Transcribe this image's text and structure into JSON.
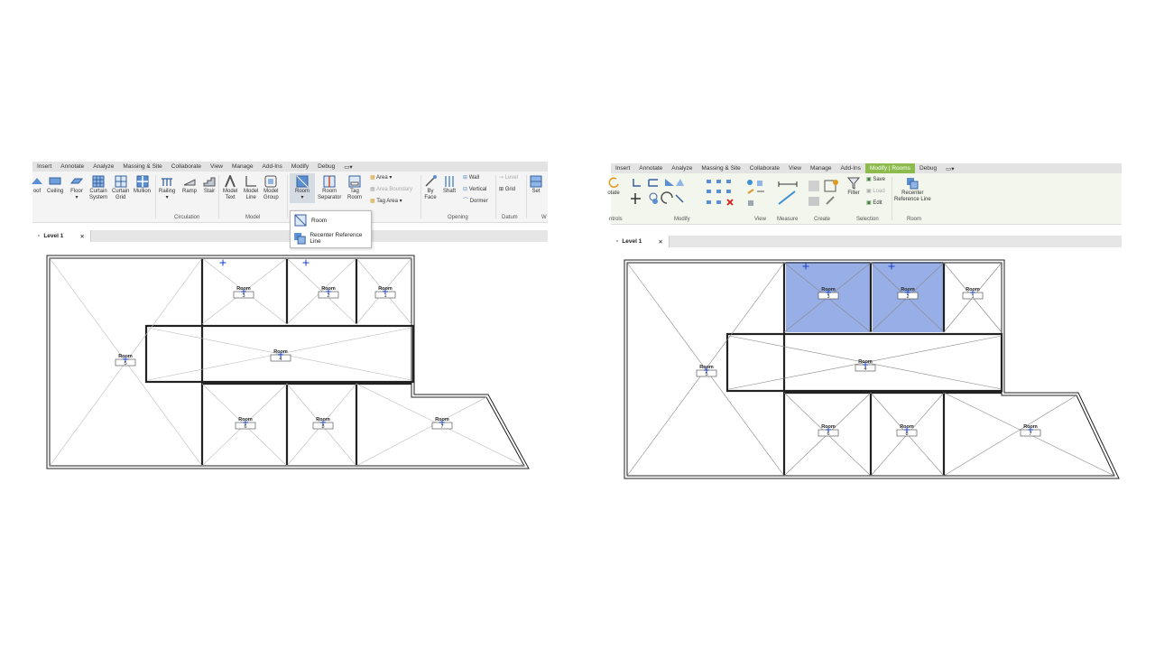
{
  "left": {
    "tabs": [
      "Insert",
      "Annotate",
      "Analyze",
      "Massing & Site",
      "Collaborate",
      "View",
      "Manage",
      "Add-Ins",
      "Modify",
      "Debug"
    ],
    "tools": {
      "roof": "oof",
      "ceiling": "Ceiling",
      "floor": "Floor",
      "curtain_system_1": "Curtain",
      "curtain_system_2": "System",
      "curtain_grid_1": "Curtain",
      "curtain_grid_2": "Grid",
      "mullion": "Mullion",
      "railing": "Railing",
      "ramp": "Ramp",
      "stair": "Stair",
      "model_text_1": "Model",
      "model_text_2": "Text",
      "model_line_1": "Model",
      "model_line_2": "Line",
      "model_group_1": "Model",
      "model_group_2": "Group",
      "room": "Room",
      "room_sep_1": "Room",
      "room_sep_2": "Separator",
      "tag_room_1": "Tag",
      "tag_room_2": "Room",
      "area": "Area",
      "area_boundary": "Area Boundary",
      "tag_area": "Area",
      "by_face_1": "By",
      "by_face_2": "Face",
      "shaft": "Shaft",
      "wall": "Wall",
      "vertical": "Vertical",
      "dormer": "Dormer",
      "level": "Level",
      "grid": "Grid",
      "set": "Set"
    },
    "groups": {
      "circulation": "Circulation",
      "model": "Model",
      "opening": "Opening",
      "datum": "Datum",
      "w": "W"
    },
    "dropdown": [
      "Room",
      "Recenter Reference Line"
    ],
    "view_tab": "Level 1"
  },
  "right": {
    "tabs": [
      "Insert",
      "Annotate",
      "Analyze",
      "Massing & Site",
      "Collaborate",
      "View",
      "Manage",
      "Add-Ins",
      "Modify | Rooms",
      "Debug"
    ],
    "active_tab": "Modify | Rooms",
    "tools": {
      "rotate": "otate",
      "filter": "Filter",
      "save": "Save",
      "load": "Load",
      "edit": "Edit",
      "recenter_1": "Recenter",
      "recenter_2": "Reference Line"
    },
    "groups": {
      "controls": "ntrols",
      "modify": "Modify",
      "view": "View",
      "measure": "Measure",
      "create": "Create",
      "selection": "Selection",
      "room": "Room"
    },
    "view_tab": "Level 1"
  },
  "rooms": [
    {
      "name": "Room",
      "number": "5"
    },
    {
      "name": "Room",
      "number": "3"
    },
    {
      "name": "Room",
      "number": "2"
    },
    {
      "name": "Room",
      "number": "1"
    },
    {
      "name": "Room",
      "number": "4"
    },
    {
      "name": "Room",
      "number": "6"
    },
    {
      "name": "Room",
      "number": "8"
    },
    {
      "name": "Room",
      "number": "7"
    }
  ],
  "colors": {
    "selection": "#98aee6",
    "accent_tab": "#8dbb4d",
    "room_marker": "#1a3fc2"
  }
}
